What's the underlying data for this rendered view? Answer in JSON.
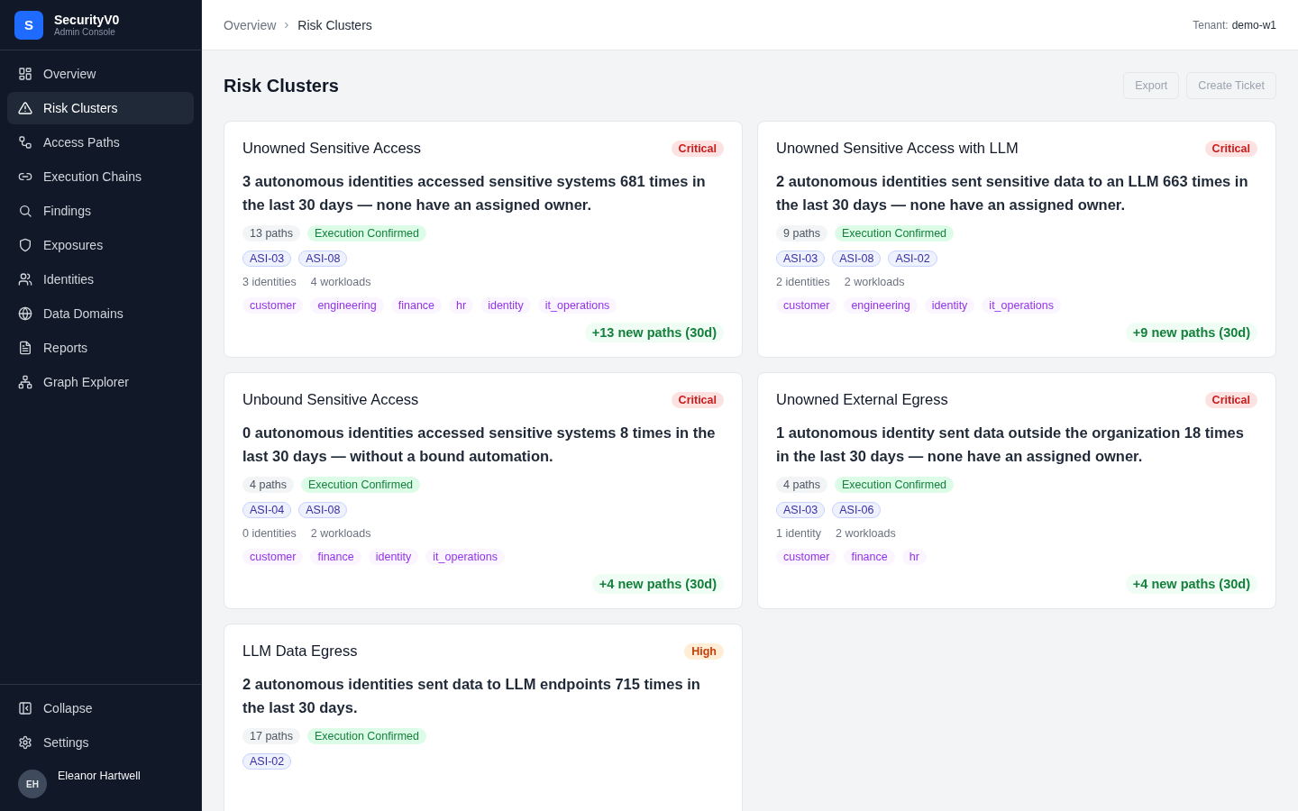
{
  "brand": {
    "logo": "S",
    "name": "SecurityV0",
    "subtitle": "Admin Console"
  },
  "nav": [
    {
      "label": "Overview",
      "selected": false
    },
    {
      "label": "Risk Clusters",
      "selected": true
    },
    {
      "label": "Access Paths",
      "selected": false
    },
    {
      "label": "Execution Chains",
      "selected": false
    },
    {
      "label": "Findings",
      "selected": false
    },
    {
      "label": "Exposures",
      "selected": false
    },
    {
      "label": "Identities",
      "selected": false
    },
    {
      "label": "Data Domains",
      "selected": false
    },
    {
      "label": "Reports",
      "selected": false
    },
    {
      "label": "Graph Explorer",
      "selected": false
    }
  ],
  "sidebar_footer": {
    "collapse": "Collapse",
    "settings": "Settings",
    "user": {
      "initials": "EH",
      "name": "Eleanor Hartwell"
    }
  },
  "breadcrumb": [
    "Overview",
    "Risk Clusters"
  ],
  "tenant": {
    "label": "Tenant:",
    "value": "demo-w1"
  },
  "page_title": "Risk Clusters",
  "actions": [
    {
      "label": "Export",
      "disabled": true
    },
    {
      "label": "Create Ticket",
      "disabled": true
    }
  ],
  "clusters": [
    {
      "title": "Unowned Sensitive Access",
      "severity": "Critical",
      "kind": "critical",
      "description": "3 autonomous identities accessed sensitive systems 681 times in the last 30 days — none have an assigned owner.",
      "paths": "13 paths",
      "status": "Execution Confirmed",
      "codes": [
        "ASI-03",
        "ASI-08"
      ],
      "identities": "3 identities",
      "workloads": "4 workloads",
      "domains": [
        "customer",
        "engineering",
        "finance",
        "hr",
        "identity",
        "it_operations"
      ],
      "trend": "+13 new paths (30d)"
    },
    {
      "title": "Unowned Sensitive Access with LLM",
      "severity": "Critical",
      "kind": "critical",
      "description": "2 autonomous identities sent sensitive data to an LLM 663 times in the last 30 days — none have an assigned owner.",
      "paths": "9 paths",
      "status": "Execution Confirmed",
      "codes": [
        "ASI-03",
        "ASI-08",
        "ASI-02"
      ],
      "identities": "2 identities",
      "workloads": "2 workloads",
      "domains": [
        "customer",
        "engineering",
        "identity",
        "it_operations"
      ],
      "trend": "+9 new paths (30d)"
    },
    {
      "title": "Unbound Sensitive Access",
      "severity": "Critical",
      "kind": "critical",
      "description": "0 autonomous identities accessed sensitive systems 8 times in the last 30 days — without a bound automation.",
      "paths": "4 paths",
      "status": "Execution Confirmed",
      "codes": [
        "ASI-04",
        "ASI-08"
      ],
      "identities": "0 identities",
      "workloads": "2 workloads",
      "domains": [
        "customer",
        "finance",
        "identity",
        "it_operations"
      ],
      "trend": "+4 new paths (30d)"
    },
    {
      "title": "Unowned External Egress",
      "severity": "Critical",
      "kind": "critical",
      "description": "1 autonomous identity sent data outside the organization 18 times in the last 30 days — none have an assigned owner.",
      "paths": "4 paths",
      "status": "Execution Confirmed",
      "codes": [
        "ASI-03",
        "ASI-06"
      ],
      "identities": "1 identity",
      "workloads": "2 workloads",
      "domains": [
        "customer",
        "finance",
        "hr"
      ],
      "trend": "+4 new paths (30d)"
    },
    {
      "title": "LLM Data Egress",
      "severity": "High",
      "kind": "high",
      "description": "2 autonomous identities sent data to LLM endpoints 715 times in the last 30 days.",
      "paths": "17 paths",
      "status": "Execution Confirmed",
      "codes": [
        "ASI-02"
      ]
    }
  ]
}
